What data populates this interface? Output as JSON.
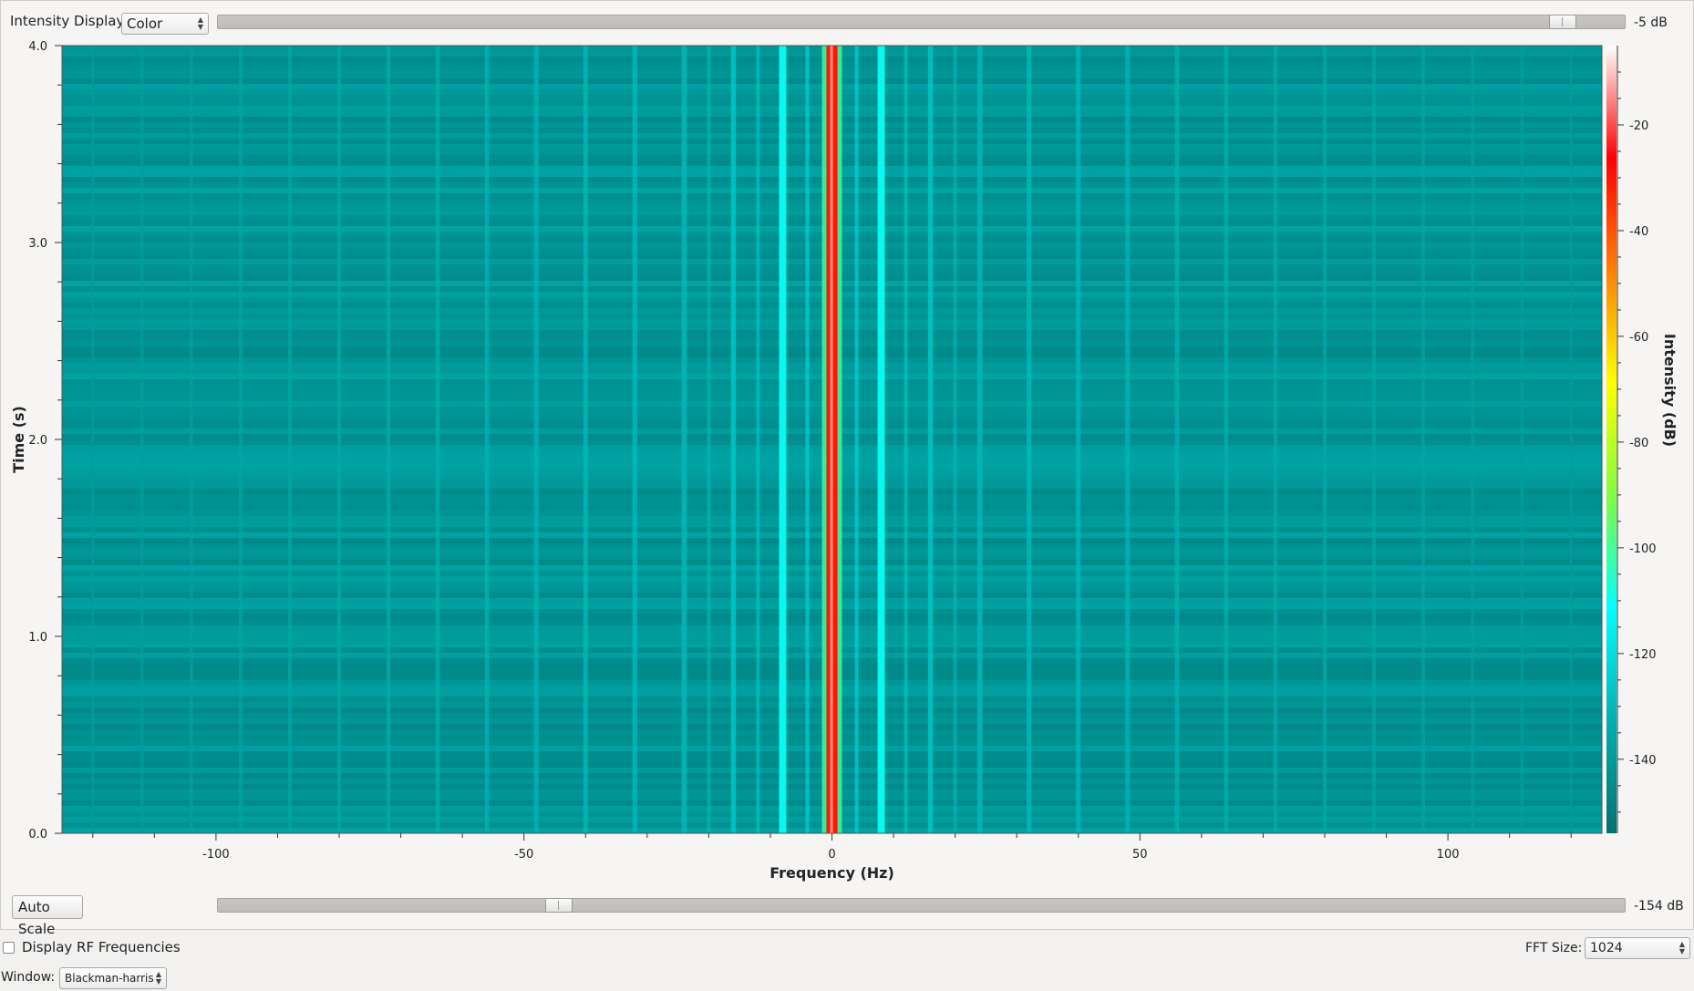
{
  "top_controls": {
    "intensity_label": "Intensity Display:",
    "intensity_value": "Color",
    "max_slider_value_label": "-5 dB",
    "max_slider_fraction": 0.965
  },
  "bottom_controls": {
    "auto_scale_label": "Auto Scale",
    "min_slider_value_label": "-154 dB",
    "min_slider_fraction": 0.237
  },
  "options": {
    "display_rf_label": "Display RF Frequencies",
    "display_rf_checked": false,
    "fft_size_label": "FFT Size:",
    "fft_size_value": "1024",
    "window_label": "Window:",
    "window_value": "Blackman-harris"
  },
  "chart_data": {
    "type": "heatmap",
    "xlabel": "Frequency (Hz)",
    "ylabel": "Time (s)",
    "colorbar_label": "Intensity (dB)",
    "xlim": [
      -125,
      125
    ],
    "ylim": [
      0.0,
      4.0
    ],
    "zlim": [
      -154,
      -5
    ],
    "x_ticks": [
      -100,
      -50,
      0,
      50,
      100
    ],
    "x_tick_labels": [
      "-100",
      "-50",
      "0",
      "50",
      "100"
    ],
    "y_ticks": [
      0.0,
      1.0,
      2.0,
      3.0,
      4.0
    ],
    "y_tick_labels": [
      "0.0",
      "1.0",
      "2.0",
      "3.0",
      "4.0"
    ],
    "colorbar_ticks": [
      -20,
      -40,
      -60,
      -80,
      -100,
      -120,
      -140
    ],
    "colorbar_tick_labels": [
      "-20",
      "-40",
      "-60",
      "-80",
      "-100",
      "-120",
      "-140"
    ],
    "colormap": [
      "#007070",
      "#00b0b0",
      "#00ffff",
      "#80ff40",
      "#ffff00",
      "#ff8000",
      "#ff0000",
      "#ffffff"
    ],
    "features": [
      {
        "description": "strong carrier",
        "frequency_hz": 0,
        "intensity_db": -30
      },
      {
        "description": "sidebands",
        "frequency_hz": [
          -8,
          8
        ],
        "intensity_db": -110
      },
      {
        "description": "harmonic lines",
        "spacing_hz": 8,
        "intensity_db": -125
      }
    ],
    "background_intensity_db": -140
  }
}
